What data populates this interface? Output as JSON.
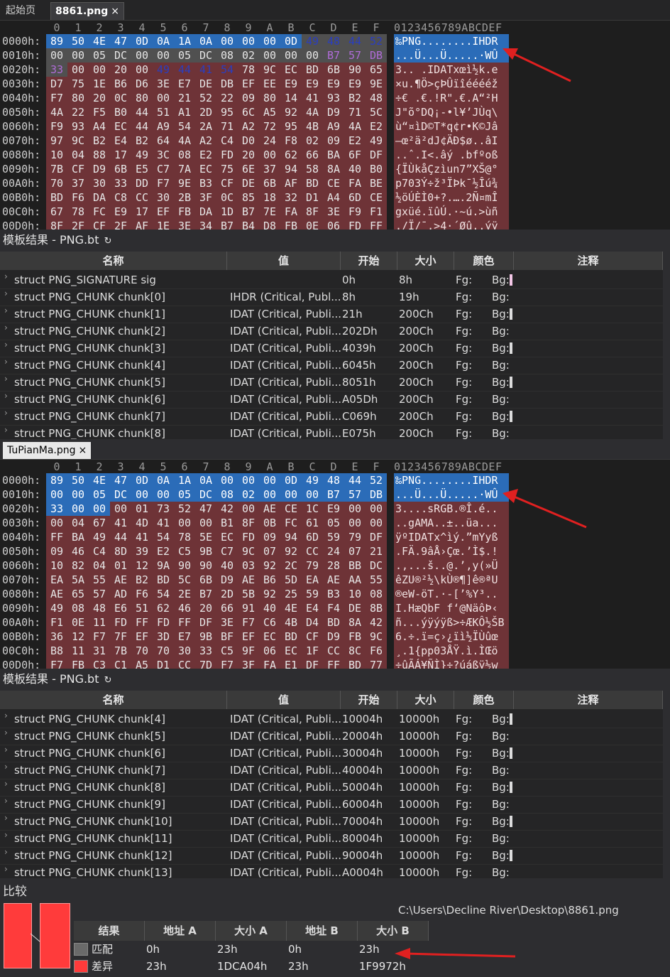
{
  "tabs1": [
    {
      "label": "起始页"
    },
    {
      "label": "8861.png",
      "close": "×"
    }
  ],
  "tabs2": [
    {
      "label": "TuPianMa.png",
      "close": "×"
    }
  ],
  "hex_header_cols": [
    "0",
    "1",
    "2",
    "3",
    "4",
    "5",
    "6",
    "7",
    "8",
    "9",
    "A",
    "B",
    "C",
    "D",
    "E",
    "F"
  ],
  "ascii_header": "0123456789ABCDEF",
  "hex1": [
    {
      "addr": "0000h:",
      "bytes": [
        "89",
        "50",
        "4E",
        "47",
        "0D",
        "0A",
        "1A",
        "0A",
        "00",
        "00",
        "00",
        "0D",
        "49",
        "48",
        "44",
        "52"
      ],
      "ascii": "‰PNG........IHDR"
    },
    {
      "addr": "0010h:",
      "bytes": [
        "00",
        "00",
        "05",
        "DC",
        "00",
        "00",
        "05",
        "DC",
        "08",
        "02",
        "00",
        "00",
        "00",
        "B7",
        "57",
        "DB"
      ],
      "ascii": "...Ü...Ü.....·WÛ"
    },
    {
      "addr": "0020h:",
      "bytes": [
        "33",
        "00",
        "00",
        "20",
        "00",
        "49",
        "44",
        "41",
        "54",
        "78",
        "9C",
        "EC",
        "BD",
        "6B",
        "90",
        "65"
      ],
      "ascii": "3.. .IDATxœì½k.e"
    },
    {
      "addr": "0030h:",
      "bytes": [
        "D7",
        "75",
        "1E",
        "B6",
        "D6",
        "3E",
        "E7",
        "DE",
        "DB",
        "EF",
        "EE",
        "E9",
        "E9",
        "E9",
        "E9",
        "9E"
      ],
      "ascii": "×u.¶Ö>çÞÛïîééééž"
    },
    {
      "addr": "0040h:",
      "bytes": [
        "F7",
        "80",
        "20",
        "0C",
        "80",
        "00",
        "21",
        "52",
        "22",
        "09",
        "80",
        "14",
        "41",
        "93",
        "B2",
        "48"
      ],
      "ascii": "÷€ .€.!R\".€.A“²H"
    },
    {
      "addr": "0050h:",
      "bytes": [
        "4A",
        "22",
        "F5",
        "B0",
        "44",
        "51",
        "A1",
        "2D",
        "95",
        "6C",
        "A5",
        "92",
        "4A",
        "D9",
        "71",
        "5C"
      ],
      "ascii": "J\"õ°DQ¡-•l¥’JÙq\\"
    },
    {
      "addr": "0060h:",
      "bytes": [
        "F9",
        "93",
        "A4",
        "EC",
        "44",
        "A9",
        "54",
        "2A",
        "71",
        "A2",
        "72",
        "95",
        "4B",
        "A9",
        "4A",
        "E2"
      ],
      "ascii": "ù“¤ìD©T*q¢r•K©Jâ"
    },
    {
      "addr": "0070h:",
      "bytes": [
        "97",
        "9C",
        "B2",
        "E4",
        "B2",
        "64",
        "4A",
        "A2",
        "C4",
        "D0",
        "24",
        "F8",
        "02",
        "09",
        "E2",
        "49"
      ],
      "ascii": "—œ²ä²dJ¢ÄÐ$ø..âI"
    },
    {
      "addr": "0080h:",
      "bytes": [
        "10",
        "04",
        "88",
        "17",
        "49",
        "3C",
        "08",
        "E2",
        "FD",
        "20",
        "00",
        "62",
        "66",
        "BA",
        "6F",
        "DF"
      ],
      "ascii": "..ˆ.I<.âý .bfºoß"
    },
    {
      "addr": "0090h:",
      "bytes": [
        "7B",
        "CF",
        "D9",
        "6B",
        "E5",
        "C7",
        "7A",
        "EC",
        "75",
        "6E",
        "37",
        "94",
        "58",
        "8A",
        "40",
        "B0"
      ],
      "ascii": "{ÏÙkåÇzìun7”XŠ@°"
    },
    {
      "addr": "00A0h:",
      "bytes": [
        "70",
        "37",
        "30",
        "33",
        "DD",
        "F7",
        "9E",
        "B3",
        "CF",
        "DE",
        "6B",
        "AF",
        "BD",
        "CE",
        "FA",
        "BE"
      ],
      "ascii": "p703Ý÷ž³ÏÞk¯½Îú¾"
    },
    {
      "addr": "00B0h:",
      "bytes": [
        "BD",
        "F6",
        "DA",
        "C8",
        "CC",
        "30",
        "2B",
        "3F",
        "0C",
        "85",
        "18",
        "32",
        "D1",
        "A4",
        "6D",
        "CE"
      ],
      "ascii": "½öÚÈÌ0+?.….2Ñ¤mÎ"
    },
    {
      "addr": "00C0h:",
      "bytes": [
        "67",
        "78",
        "FC",
        "E9",
        "17",
        "EF",
        "FB",
        "DA",
        "1D",
        "B7",
        "7E",
        "FA",
        "8F",
        "3E",
        "F9",
        "F1"
      ],
      "ascii": "gxüé.ïûÚ.·~ú.>ùñ"
    },
    {
      "addr": "00D0h:",
      "bytes": [
        "8F",
        "2F",
        "CF",
        "2F",
        "AF",
        "1E",
        "3E",
        "34",
        "B7",
        "B4",
        "D8",
        "FB",
        "0E",
        "06",
        "FD",
        "FF"
      ],
      "ascii": "./Ï/¯.>4·´Øû..ýÿ"
    }
  ],
  "hex2": [
    {
      "addr": "0000h:",
      "bytes": [
        "89",
        "50",
        "4E",
        "47",
        "0D",
        "0A",
        "1A",
        "0A",
        "00",
        "00",
        "00",
        "0D",
        "49",
        "48",
        "44",
        "52"
      ],
      "ascii": "‰PNG........IHDR"
    },
    {
      "addr": "0010h:",
      "bytes": [
        "00",
        "00",
        "05",
        "DC",
        "00",
        "00",
        "05",
        "DC",
        "08",
        "02",
        "00",
        "00",
        "00",
        "B7",
        "57",
        "DB"
      ],
      "ascii": "...Ü...Ü.....·WÛ"
    },
    {
      "addr": "0020h:",
      "bytes": [
        "33",
        "00",
        "00",
        "00",
        "01",
        "73",
        "52",
        "47",
        "42",
        "00",
        "AE",
        "CE",
        "1C",
        "E9",
        "00",
        "00"
      ],
      "ascii": "3....sRGB.®Î.é.."
    },
    {
      "addr": "0030h:",
      "bytes": [
        "00",
        "04",
        "67",
        "41",
        "4D",
        "41",
        "00",
        "00",
        "B1",
        "8F",
        "0B",
        "FC",
        "61",
        "05",
        "00",
        "00"
      ],
      "ascii": "..gAMA..±..üa..."
    },
    {
      "addr": "0040h:",
      "bytes": [
        "FF",
        "BA",
        "49",
        "44",
        "41",
        "54",
        "78",
        "5E",
        "EC",
        "FD",
        "09",
        "94",
        "6D",
        "59",
        "79",
        "DF"
      ],
      "ascii": "ÿºIDATx^ìý.”mYyß"
    },
    {
      "addr": "0050h:",
      "bytes": [
        "09",
        "46",
        "C4",
        "8D",
        "39",
        "E2",
        "C5",
        "9B",
        "C7",
        "9C",
        "07",
        "92",
        "CC",
        "24",
        "07",
        "21"
      ],
      "ascii": ".FÄ.9âÅ›Çœ.’Ì$.!"
    },
    {
      "addr": "0060h:",
      "bytes": [
        "10",
        "82",
        "04",
        "01",
        "12",
        "9A",
        "90",
        "90",
        "40",
        "03",
        "92",
        "2C",
        "79",
        "28",
        "BB",
        "DC"
      ],
      "ascii": ".‚...š..@.’,y(»Ü"
    },
    {
      "addr": "0070h:",
      "bytes": [
        "EA",
        "5A",
        "55",
        "AE",
        "B2",
        "BD",
        "5C",
        "6B",
        "D9",
        "AE",
        "B6",
        "5D",
        "EA",
        "AE",
        "AA",
        "55"
      ],
      "ascii": "êZU®²½\\kÙ®¶]ê®ªU"
    },
    {
      "addr": "0080h:",
      "bytes": [
        "AE",
        "65",
        "57",
        "AD",
        "F6",
        "54",
        "2E",
        "B7",
        "2D",
        "5B",
        "92",
        "25",
        "59",
        "B3",
        "10",
        "08"
      ],
      "ascii": "®eW-öT.·-[’%Y³.."
    },
    {
      "addr": "0090h:",
      "bytes": [
        "49",
        "08",
        "48",
        "E6",
        "51",
        "62",
        "46",
        "20",
        "66",
        "91",
        "40",
        "4E",
        "E4",
        "F4",
        "DE",
        "8B"
      ],
      "ascii": "I.HæQbF f‘@NäôÞ‹"
    },
    {
      "addr": "00A0h:",
      "bytes": [
        "F1",
        "0E",
        "11",
        "FD",
        "FF",
        "FD",
        "FF",
        "DF",
        "3E",
        "F7",
        "C6",
        "4B",
        "D4",
        "BD",
        "8A",
        "42"
      ],
      "ascii": "ñ...ýÿýÿß>÷ÆKÔ½ŠB"
    },
    {
      "addr": "00B0h:",
      "bytes": [
        "36",
        "12",
        "F7",
        "7F",
        "EF",
        "3D",
        "E7",
        "9B",
        "BF",
        "EF",
        "EC",
        "BD",
        "CF",
        "D9",
        "FB",
        "9C"
      ],
      "ascii": "6.÷.ï=ç›¿ïì½ÏÙûœ"
    },
    {
      "addr": "00C0h:",
      "bytes": [
        "B8",
        "11",
        "31",
        "7B",
        "70",
        "70",
        "30",
        "33",
        "C5",
        "9F",
        "06",
        "EC",
        "1F",
        "CC",
        "8C",
        "F6"
      ],
      "ascii": "¸.1{pp03ÅŸ.ì.ÌŒö"
    },
    {
      "addr": "00D0h:",
      "bytes": [
        "F7",
        "FB",
        "C3",
        "C1",
        "A5",
        "D1",
        "CC",
        "7D",
        "F7",
        "3F",
        "FA",
        "E1",
        "DF",
        "FF",
        "BD",
        "77"
      ],
      "ascii": "÷ûÃÁ¥ÑÌ}÷?úáßÿ½w"
    }
  ],
  "template1": {
    "title": "模板结果 - PNG.bt",
    "refresh_icon": "↻",
    "columns": [
      "名称",
      "值",
      "开始",
      "大小",
      "颜色",
      "注释"
    ],
    "rows": [
      {
        "name": "struct PNG_SIGNATURE sig",
        "value": "",
        "start": "0h",
        "size": "8h",
        "fg": "Fg:",
        "bg": "Bg:"
      },
      {
        "name": "struct PNG_CHUNK chunk[0]",
        "value": "IHDR  (Critical, Publ...",
        "start": "8h",
        "size": "19h",
        "fg": "Fg:",
        "bg": "Bg:"
      },
      {
        "name": "struct PNG_CHUNK chunk[1]",
        "value": "IDAT  (Critical, Publi...",
        "start": "21h",
        "size": "200Ch",
        "fg": "Fg:",
        "bg": "Bg:"
      },
      {
        "name": "struct PNG_CHUNK chunk[2]",
        "value": "IDAT  (Critical, Publi...",
        "start": "202Dh",
        "size": "200Ch",
        "fg": "Fg:",
        "bg": "Bg:"
      },
      {
        "name": "struct PNG_CHUNK chunk[3]",
        "value": "IDAT  (Critical, Publi...",
        "start": "4039h",
        "size": "200Ch",
        "fg": "Fg:",
        "bg": "Bg:"
      },
      {
        "name": "struct PNG_CHUNK chunk[4]",
        "value": "IDAT  (Critical, Publi...",
        "start": "6045h",
        "size": "200Ch",
        "fg": "Fg:",
        "bg": "Bg:"
      },
      {
        "name": "struct PNG_CHUNK chunk[5]",
        "value": "IDAT  (Critical, Publi...",
        "start": "8051h",
        "size": "200Ch",
        "fg": "Fg:",
        "bg": "Bg:"
      },
      {
        "name": "struct PNG_CHUNK chunk[6]",
        "value": "IDAT  (Critical, Publi...",
        "start": "A05Dh",
        "size": "200Ch",
        "fg": "Fg:",
        "bg": "Bg:"
      },
      {
        "name": "struct PNG_CHUNK chunk[7]",
        "value": "IDAT  (Critical, Publi...",
        "start": "C069h",
        "size": "200Ch",
        "fg": "Fg:",
        "bg": "Bg:"
      },
      {
        "name": "struct PNG_CHUNK chunk[8]",
        "value": "IDAT  (Critical, Publi...",
        "start": "E075h",
        "size": "200Ch",
        "fg": "Fg:",
        "bg": "Bg:"
      }
    ]
  },
  "template2": {
    "title": "模板结果 - PNG.bt",
    "refresh_icon": "↻",
    "columns": [
      "名称",
      "值",
      "开始",
      "大小",
      "颜色",
      "注释"
    ],
    "rows": [
      {
        "name": "struct PNG_CHUNK chunk[4]",
        "value": "IDAT  (Critical, Publi...",
        "start": "10004h",
        "size": "10000h",
        "fg": "Fg:",
        "bg": "Bg:"
      },
      {
        "name": "struct PNG_CHUNK chunk[5]",
        "value": "IDAT  (Critical, Publi...",
        "start": "20004h",
        "size": "10000h",
        "fg": "Fg:",
        "bg": "Bg:"
      },
      {
        "name": "struct PNG_CHUNK chunk[6]",
        "value": "IDAT  (Critical, Publi...",
        "start": "30004h",
        "size": "10000h",
        "fg": "Fg:",
        "bg": "Bg:"
      },
      {
        "name": "struct PNG_CHUNK chunk[7]",
        "value": "IDAT  (Critical, Publi...",
        "start": "40004h",
        "size": "10000h",
        "fg": "Fg:",
        "bg": "Bg:"
      },
      {
        "name": "struct PNG_CHUNK chunk[8]",
        "value": "IDAT  (Critical, Publi...",
        "start": "50004h",
        "size": "10000h",
        "fg": "Fg:",
        "bg": "Bg:"
      },
      {
        "name": "struct PNG_CHUNK chunk[9]",
        "value": "IDAT  (Critical, Publi...",
        "start": "60004h",
        "size": "10000h",
        "fg": "Fg:",
        "bg": "Bg:"
      },
      {
        "name": "struct PNG_CHUNK chunk[10]",
        "value": "IDAT  (Critical, Publi...",
        "start": "70004h",
        "size": "10000h",
        "fg": "Fg:",
        "bg": "Bg:"
      },
      {
        "name": "struct PNG_CHUNK chunk[11]",
        "value": "IDAT  (Critical, Publi...",
        "start": "80004h",
        "size": "10000h",
        "fg": "Fg:",
        "bg": "Bg:"
      },
      {
        "name": "struct PNG_CHUNK chunk[12]",
        "value": "IDAT  (Critical, Publi...",
        "start": "90004h",
        "size": "10000h",
        "fg": "Fg:",
        "bg": "Bg:"
      },
      {
        "name": "struct PNG_CHUNK chunk[13]",
        "value": "IDAT  (Critical, Publi...",
        "start": "A0004h",
        "size": "10000h",
        "fg": "Fg:",
        "bg": "Bg:"
      }
    ]
  },
  "compare": {
    "title": "比较",
    "path": "C:\\Users\\Decline River\\Desktop\\8861.png",
    "columns": [
      "结果",
      "地址 A",
      "大小 A",
      "地址 B",
      "大小 B"
    ],
    "rows": [
      {
        "result": "匹配",
        "addr_a": "0h",
        "size_a": "23h",
        "addr_b": "0h",
        "size_b": "23h",
        "color": "#6a6a6a"
      },
      {
        "result": "差异",
        "addr_a": "23h",
        "size_a": "1DCA04h",
        "addr_b": "23h",
        "size_b": "1F9972h",
        "color": "#ff3b3b"
      }
    ]
  },
  "colors": {
    "byte_bg": "#6e3337",
    "selection": "#2b6cb8",
    "arrow": "#e02020"
  }
}
